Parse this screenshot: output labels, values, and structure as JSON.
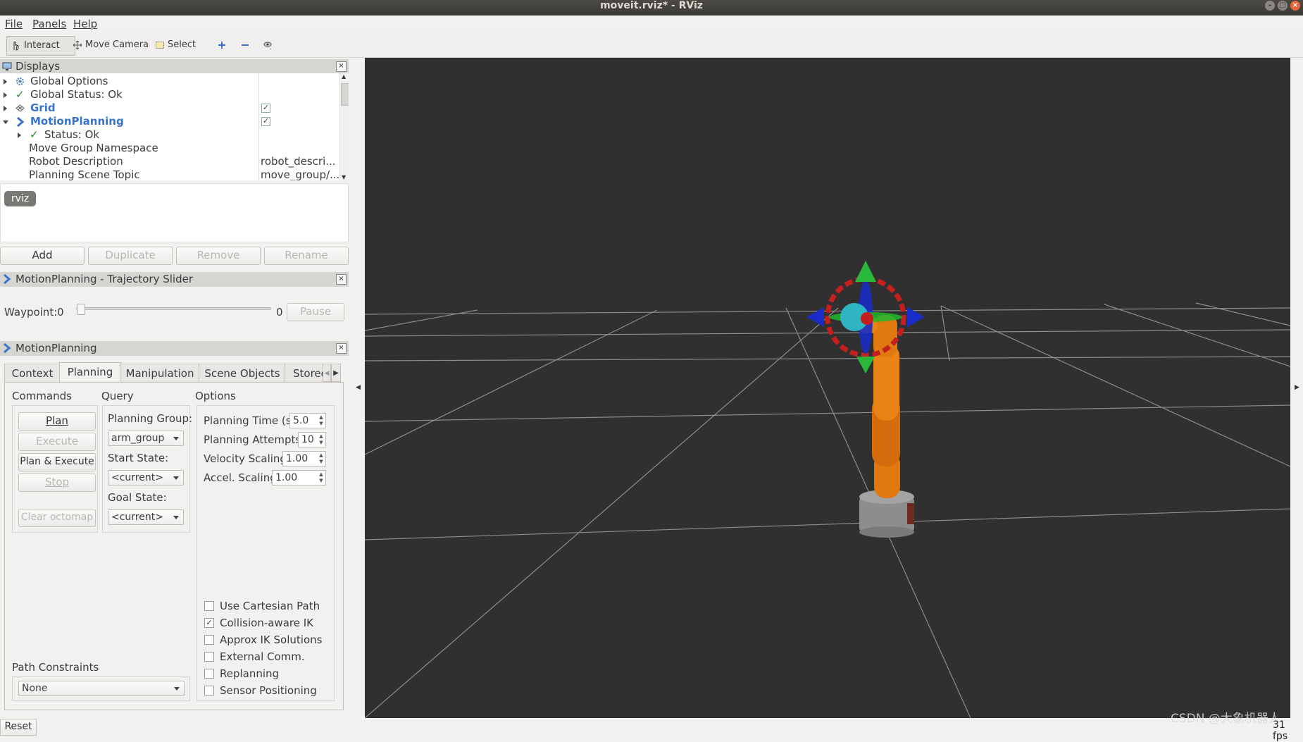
{
  "window": {
    "title": "moveit.rviz* - RViz"
  },
  "menu": {
    "items": [
      "File",
      "Panels",
      "Help"
    ]
  },
  "toolbar": {
    "interact": "Interact",
    "move_camera": "Move Camera",
    "select": "Select"
  },
  "displays": {
    "title": "Displays",
    "rows": [
      {
        "label": "Global Options"
      },
      {
        "label": "Global Status: Ok"
      },
      {
        "label": "Grid",
        "checked": true
      },
      {
        "label": "MotionPlanning",
        "checked": true
      },
      {
        "label": "Status: Ok"
      },
      {
        "label": "Move Group Namespace"
      },
      {
        "label": "Robot Description",
        "value": "robot_descri..."
      },
      {
        "label": "Planning Scene Topic",
        "value": "move_group/..."
      }
    ],
    "tag": "rviz",
    "buttons": {
      "add": "Add",
      "duplicate": "Duplicate",
      "remove": "Remove",
      "rename": "Rename"
    }
  },
  "trajectory_slider": {
    "title": "MotionPlanning - Trajectory Slider",
    "waypoint_label": "Waypoint:",
    "waypoint_value": "0",
    "max_value": "0",
    "pause": "Pause"
  },
  "motion_planning": {
    "title": "MotionPlanning",
    "tabs": [
      "Context",
      "Planning",
      "Manipulation",
      "Scene Objects",
      "Stored"
    ],
    "active_tab": "Planning",
    "commands": {
      "heading": "Commands",
      "plan": "Plan",
      "execute": "Execute",
      "plan_execute": "Plan & Execute",
      "stop": "Stop",
      "clear_octomap": "Clear octomap"
    },
    "query": {
      "heading": "Query",
      "planning_group_label": "Planning Group:",
      "planning_group": "arm_group",
      "start_state_label": "Start State:",
      "start_state": "<current>",
      "goal_state_label": "Goal State:",
      "goal_state": "<current>"
    },
    "options": {
      "heading": "Options",
      "planning_time_label": "Planning Time (s):",
      "planning_time": "5.0",
      "planning_attempts_label": "Planning Attempts:",
      "planning_attempts": "10",
      "velocity_scaling_label": "Velocity Scaling:",
      "velocity_scaling": "1.00",
      "accel_scaling_label": "Accel. Scaling:",
      "accel_scaling": "1.00",
      "checkboxes": [
        {
          "label": "Use Cartesian Path",
          "checked": false
        },
        {
          "label": "Collision-aware IK",
          "checked": true
        },
        {
          "label": "Approx IK Solutions",
          "checked": false
        },
        {
          "label": "External Comm.",
          "checked": false
        },
        {
          "label": "Replanning",
          "checked": false
        },
        {
          "label": "Sensor Positioning",
          "checked": false
        }
      ]
    },
    "path_constraints": {
      "label": "Path Constraints",
      "value": "None"
    }
  },
  "bottom": {
    "reset": "Reset",
    "fps": "31 fps",
    "watermark": "CSDN @大象机器人"
  },
  "colors": {
    "viewport_bg": "#303030",
    "robot_orange": "#e0790f",
    "accent_blue": "#3874c9"
  }
}
